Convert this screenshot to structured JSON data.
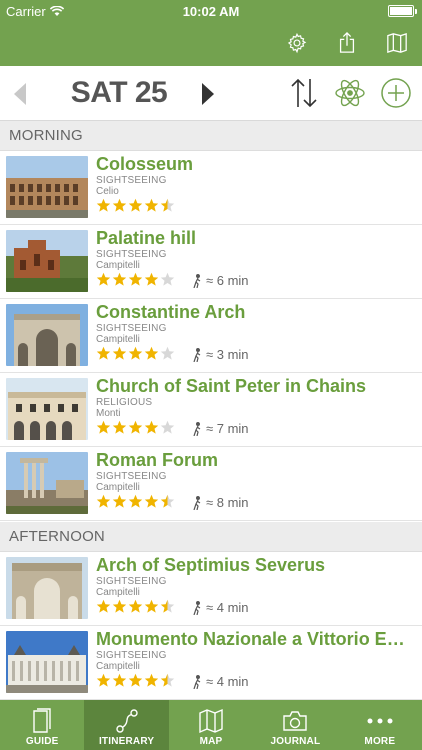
{
  "status": {
    "carrier": "Carrier",
    "time": "10:02 AM"
  },
  "colors": {
    "brand": "#73a24f",
    "title": "#6a9e3d",
    "star": "#f0b400"
  },
  "nav": {
    "icons": [
      "gear-icon",
      "share-icon",
      "map-book-icon"
    ]
  },
  "datebar": {
    "date": "SAT 25",
    "tools": [
      "sort-icon",
      "atom-icon",
      "add-icon"
    ]
  },
  "sections": [
    {
      "label": "MORNING"
    },
    {
      "label": "AFTERNOON"
    }
  ],
  "items": [
    {
      "title": "Colosseum",
      "category": "SIGHTSEEING",
      "area": "Celio",
      "rating": 4.5,
      "walk": ""
    },
    {
      "title": "Palatine hill",
      "category": "SIGHTSEEING",
      "area": "Campitelli",
      "rating": 4,
      "walk": "≈ 6 min"
    },
    {
      "title": "Constantine Arch",
      "category": "SIGHTSEEING",
      "area": "Campitelli",
      "rating": 4,
      "walk": "≈ 3 min"
    },
    {
      "title": "Church of Saint Peter in Chains",
      "category": "RELIGIOUS",
      "area": "Monti",
      "rating": 4,
      "walk": "≈ 7 min"
    },
    {
      "title": "Roman Forum",
      "category": "SIGHTSEEING",
      "area": "Campitelli",
      "rating": 4.5,
      "walk": "≈ 8 min"
    },
    {
      "title": "Arch of Septimius Severus",
      "category": "SIGHTSEEING",
      "area": "Campitelli",
      "rating": 4.5,
      "walk": "≈ 4 min"
    },
    {
      "title": "Monumento Nazionale a Vittorio Emanuele...",
      "category": "SIGHTSEEING",
      "area": "Campitelli",
      "rating": 4.5,
      "walk": "≈ 4 min"
    }
  ],
  "tabs": [
    {
      "label": "GUIDE",
      "icon": "book-icon",
      "active": false
    },
    {
      "label": "ITINERARY",
      "icon": "route-icon",
      "active": true
    },
    {
      "label": "MAP",
      "icon": "map-icon",
      "active": false
    },
    {
      "label": "JOURNAL",
      "icon": "camera-icon",
      "active": false
    },
    {
      "label": "MORE",
      "icon": "more-icon",
      "active": false
    }
  ]
}
